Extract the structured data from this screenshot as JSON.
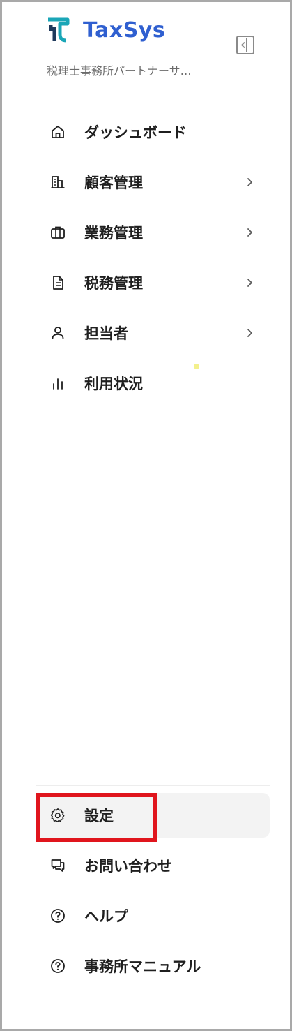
{
  "brand": {
    "name": "TaxSys",
    "office_name": "税理士事務所パートナーサ…",
    "brand_color": "#2f5fd0",
    "logo_color": "#1aa6b7"
  },
  "sidebar": {
    "collapse_icon": "sidebar-collapse-icon",
    "items": [
      {
        "label": "ダッシュボード",
        "icon": "home-icon",
        "has_submenu": false
      },
      {
        "label": "顧客管理",
        "icon": "building-icon",
        "has_submenu": true
      },
      {
        "label": "業務管理",
        "icon": "briefcase-icon",
        "has_submenu": true
      },
      {
        "label": "税務管理",
        "icon": "document-icon",
        "has_submenu": true
      },
      {
        "label": "担当者",
        "icon": "user-icon",
        "has_submenu": true
      },
      {
        "label": "利用状況",
        "icon": "bar-chart-icon",
        "has_submenu": false
      }
    ],
    "bottom_items": [
      {
        "label": "設定",
        "icon": "gear-icon",
        "active": true
      },
      {
        "label": "お問い合わせ",
        "icon": "chat-icon",
        "active": false
      },
      {
        "label": "ヘルプ",
        "icon": "help-circle-icon",
        "active": false
      },
      {
        "label": "事務所マニュアル",
        "icon": "help-circle-icon",
        "active": false
      }
    ]
  },
  "colors": {
    "text": "#1f1f1f",
    "muted": "#6b6b6b",
    "active_bg": "#f3f3f3",
    "highlight": "#e0151d"
  }
}
